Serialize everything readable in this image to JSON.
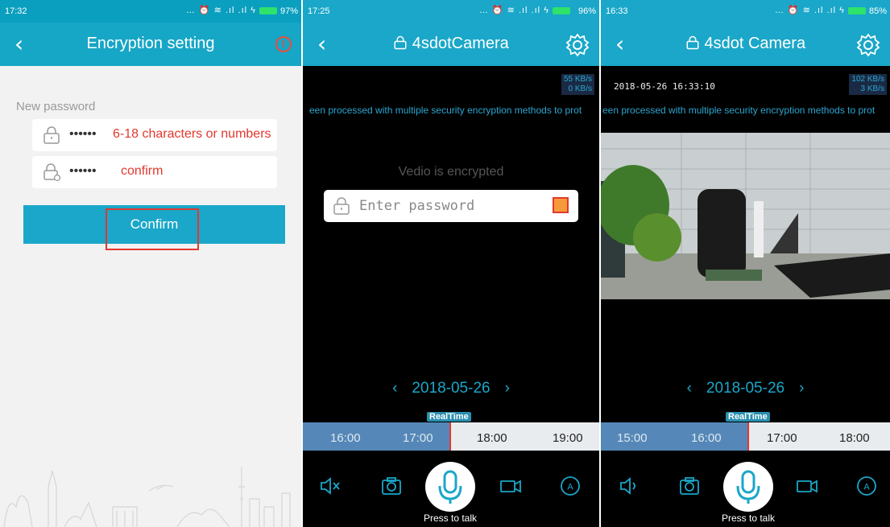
{
  "panel1": {
    "status_time": "17:32",
    "status_icons": "… ⏰ ≋ .ıl .ıl ϟ",
    "battery": "97%",
    "title": "Encryption setting",
    "new_password_label": "New password",
    "password_dots": "••••••",
    "password_hint": "6-18 characters or numbers",
    "confirm_dots": "••••••",
    "confirm_hint": "confirm",
    "confirm_button": "Confirm"
  },
  "panel2": {
    "status_time": "17:25",
    "status_icons": "… ⏰ ≋ .ıl .ıl ϟ",
    "battery": "96%",
    "title": "4sdotCamera",
    "speed_in": "55 KB/s",
    "speed_out": "0 KB/s",
    "ticker": "een processed with multiple security encryption methods to prot",
    "encrypted_text": "Vedio is encrypted",
    "password_placeholder": "Enter password",
    "date": "2018-05-26",
    "realtime": "RealTime",
    "ticks": [
      "16:00",
      "17:00",
      "18:00",
      "19:00"
    ],
    "talk": "Press to talk"
  },
  "panel3": {
    "status_time": "16:33",
    "status_icons": "… ⏰ ≋ .ıl .ıl ϟ",
    "battery": "85%",
    "title": "4sdot Camera",
    "speed_in": "102 KB/s",
    "speed_out": "3 KB/s",
    "timestamp": "2018-05-26 16:33:10",
    "ticker": "een processed with multiple security encryption methods to prot",
    "date": "2018-05-26",
    "realtime": "RealTime",
    "ticks": [
      "15:00",
      "16:00",
      "17:00",
      "18:00"
    ],
    "talk": "Press to talk"
  },
  "icons": {
    "back": "‹",
    "lock_title": "lock-icon",
    "settings": "gear-icon",
    "alert": "!",
    "prev": "‹",
    "next": "›"
  },
  "colors": {
    "accent": "#1aa7c9",
    "error": "#e2382e"
  }
}
